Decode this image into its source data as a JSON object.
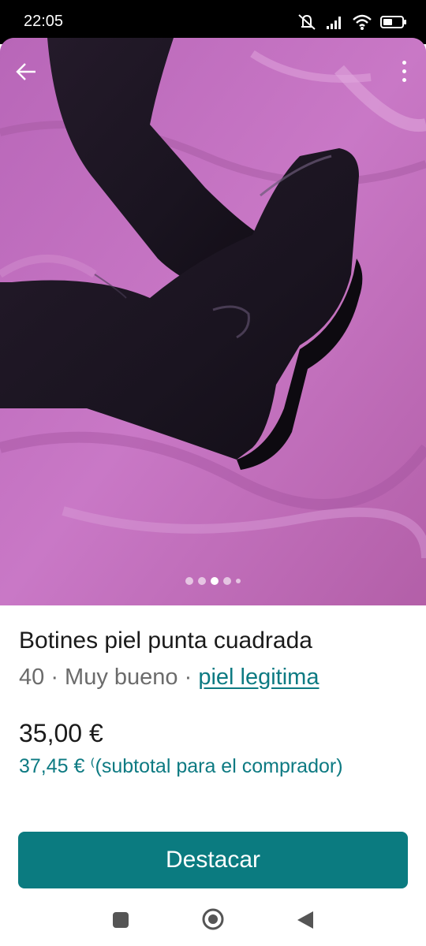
{
  "status_bar": {
    "time": "22:05",
    "icons": [
      "mute-icon",
      "signal-icon",
      "wifi-icon",
      "battery-icon"
    ]
  },
  "photo": {
    "pager": {
      "count": 5,
      "active_index": 2
    }
  },
  "item": {
    "title": "Botines piel punta cuadrada",
    "size": "40",
    "separator": " · ",
    "condition": "Muy bueno",
    "brand": "piel legitima",
    "price": "35,00 €",
    "subtotal": "37,45 € ⁽(subtotal para el comprador)"
  },
  "actions": {
    "primary_label": "Destacar"
  },
  "colors": {
    "accent": "#0b7b80",
    "link": "#0d7a82"
  },
  "navigation": {
    "icons": [
      "recents-icon",
      "home-icon",
      "back-icon"
    ]
  }
}
